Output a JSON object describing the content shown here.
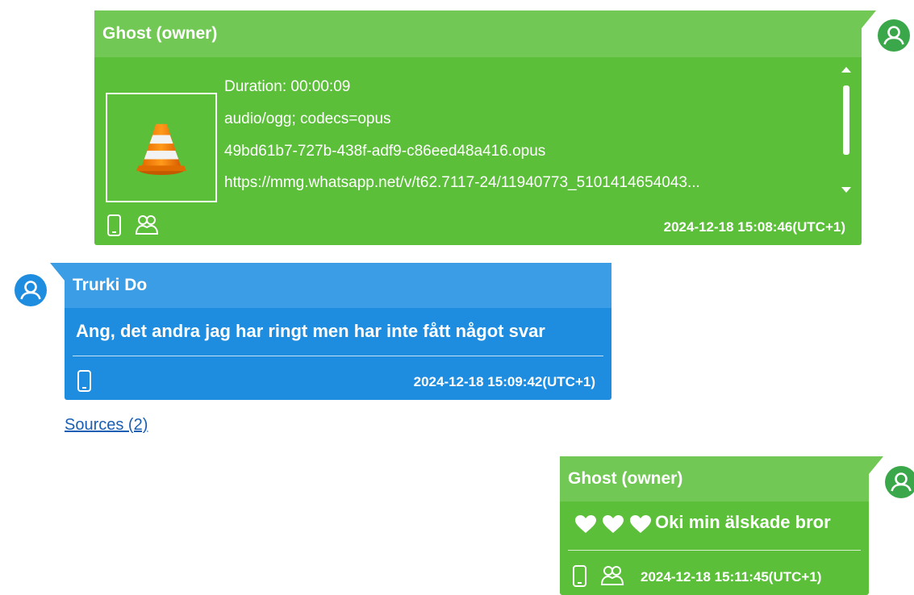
{
  "messages": [
    {
      "sender": "Ghost (owner)",
      "attachment": {
        "duration": "Duration: 00:00:09",
        "mime": "audio/ogg; codecs=opus",
        "filename": "49bd61b7-727b-438f-adf9-c86eed48a416.opus",
        "url": "https://mmg.whatsapp.net/v/t62.7117-24/11940773_5101414654043...",
        "thumbnail_icon": "vlc-cone-icon"
      },
      "timestamp": "2024-12-18 15:08:46(UTC+1)",
      "icons": [
        "phone-icon",
        "group-icon"
      ]
    },
    {
      "sender": "Trurki Do",
      "text": "Ang, det andra jag har ringt men har inte fått något svar",
      "timestamp": "2024-12-18 15:09:42(UTC+1)",
      "icons": [
        "phone-icon"
      ],
      "sources_label": "Sources (2)"
    },
    {
      "sender": "Ghost (owner)",
      "text": "Oki min älskade bror",
      "emoji": "heart-icon x3",
      "timestamp": "2024-12-18 15:11:45(UTC+1)",
      "icons": [
        "phone-icon",
        "group-icon"
      ]
    }
  ],
  "colors": {
    "owner_bubble": "#5cbf3a",
    "owner_header": "#72c855",
    "contact_bubble": "#1e8de0",
    "contact_header": "#3a9de5",
    "owner_avatar": "#3aa84a",
    "contact_avatar": "#1e8de0",
    "link": "#1a5fb4"
  }
}
